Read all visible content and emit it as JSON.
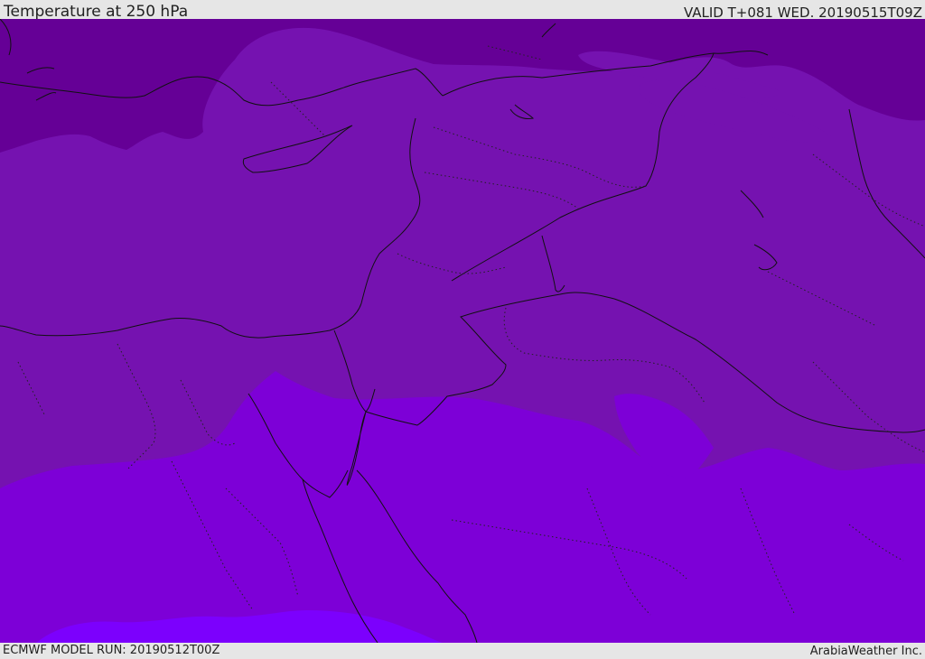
{
  "header": {
    "title": "Temperature at 250 hPa",
    "valid_time": "VALID T+081 WED. 20190515T09Z"
  },
  "footer": {
    "model_run": "ECMWF MODEL RUN: 20190512T00Z",
    "credit": "ArabiaWeather Inc."
  },
  "colors": {
    "coldest_band": "#650096",
    "cold_band": "#7512b0",
    "mid_band": "#7d00d7",
    "warm_band": "#7c00fd",
    "border_line": "#111111",
    "header_background": "#e6e6e6"
  },
  "map": {
    "field": "Temperature",
    "level": "250 hPa"
  }
}
